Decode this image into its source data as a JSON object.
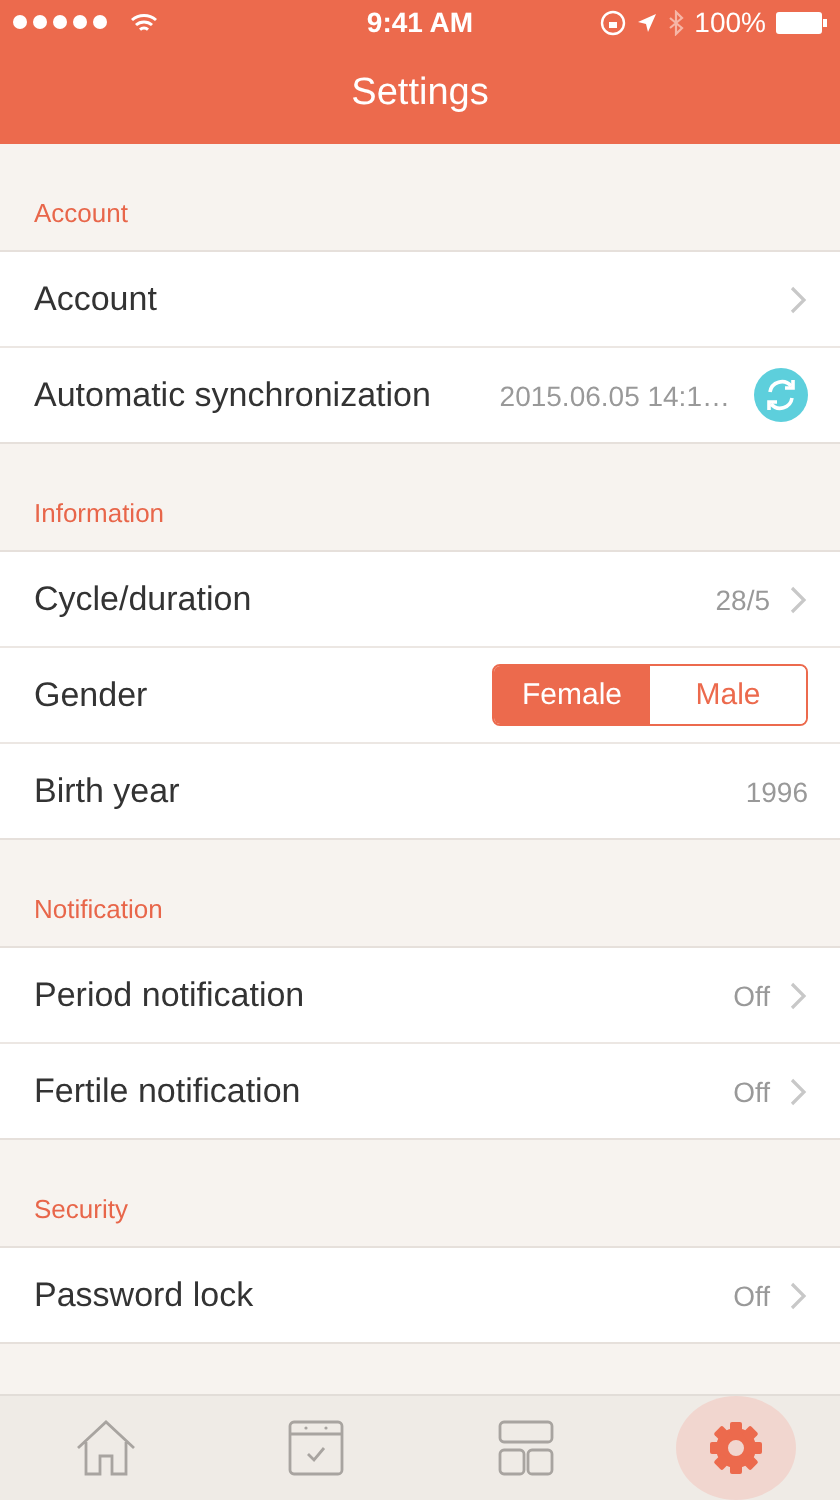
{
  "status_bar": {
    "time": "9:41 AM",
    "battery": "100%"
  },
  "title": "Settings",
  "sections": [
    {
      "title": "Account",
      "rows": [
        {
          "kind": "link",
          "label": "Account"
        },
        {
          "kind": "sync",
          "label": "Automatic synchronization",
          "value": "2015.06.05 14:1…"
        }
      ]
    },
    {
      "title": "Information",
      "rows": [
        {
          "kind": "link",
          "label": "Cycle/duration",
          "value": "28/5"
        },
        {
          "kind": "segmented",
          "label": "Gender",
          "options": [
            {
              "label": "Female",
              "selected": true
            },
            {
              "label": "Male",
              "selected": false
            }
          ]
        },
        {
          "kind": "value",
          "label": "Birth year",
          "value": "1996"
        }
      ]
    },
    {
      "title": "Notification",
      "rows": [
        {
          "kind": "link",
          "label": "Period notification",
          "value": "Off"
        },
        {
          "kind": "link",
          "label": "Fertile notification",
          "value": "Off"
        }
      ]
    },
    {
      "title": "Security",
      "rows": [
        {
          "kind": "link",
          "label": "Password lock",
          "value": "Off"
        }
      ]
    }
  ],
  "tabs": [
    {
      "kind": "home",
      "selected": false
    },
    {
      "kind": "calendar",
      "selected": false
    },
    {
      "kind": "layout",
      "selected": false
    },
    {
      "kind": "settings",
      "selected": true
    }
  ]
}
